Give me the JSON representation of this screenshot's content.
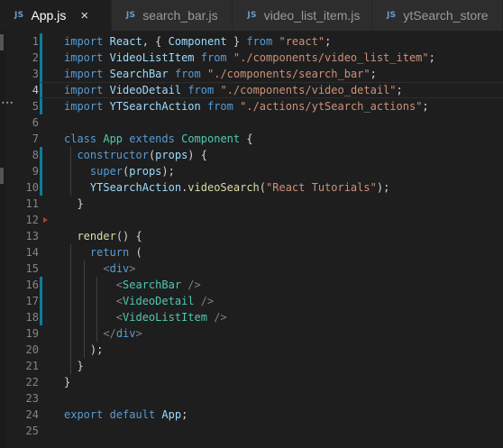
{
  "tabs": [
    {
      "icon": "JS",
      "label": "App.js",
      "active": true,
      "close": "×"
    },
    {
      "icon": "JS",
      "label": "search_bar.js",
      "active": false
    },
    {
      "icon": "JS",
      "label": "video_list_item.js",
      "active": false
    },
    {
      "icon": "JS",
      "label": "ytSearch_store",
      "active": false
    }
  ],
  "current_line": 4,
  "lines": [
    {
      "n": 1,
      "tokens": [
        [
          "kw",
          "import"
        ],
        [
          "pun",
          " "
        ],
        [
          "id",
          "React"
        ],
        [
          "pun",
          ", { "
        ],
        [
          "id",
          "Component"
        ],
        [
          "pun",
          " } "
        ],
        [
          "kw",
          "from"
        ],
        [
          "pun",
          " "
        ],
        [
          "str",
          "\"react\""
        ],
        [
          "pun",
          ";"
        ]
      ]
    },
    {
      "n": 2,
      "tokens": [
        [
          "kw",
          "import"
        ],
        [
          "pun",
          " "
        ],
        [
          "id",
          "VideoListItem"
        ],
        [
          "pun",
          " "
        ],
        [
          "kw",
          "from"
        ],
        [
          "pun",
          " "
        ],
        [
          "str",
          "\"./components/video_list_item\""
        ],
        [
          "pun",
          ";"
        ]
      ]
    },
    {
      "n": 3,
      "tokens": [
        [
          "kw",
          "import"
        ],
        [
          "pun",
          " "
        ],
        [
          "id",
          "SearchBar"
        ],
        [
          "pun",
          " "
        ],
        [
          "kw",
          "from"
        ],
        [
          "pun",
          " "
        ],
        [
          "str",
          "\"./components/search_bar\""
        ],
        [
          "pun",
          ";"
        ]
      ]
    },
    {
      "n": 4,
      "tokens": [
        [
          "kw",
          "import"
        ],
        [
          "pun",
          " "
        ],
        [
          "id",
          "VideoDetail"
        ],
        [
          "pun",
          " "
        ],
        [
          "kw",
          "from"
        ],
        [
          "pun",
          " "
        ],
        [
          "str",
          "\"./components/video_detail\""
        ],
        [
          "pun",
          ";"
        ]
      ]
    },
    {
      "n": 5,
      "tokens": [
        [
          "kw",
          "import"
        ],
        [
          "pun",
          " "
        ],
        [
          "id",
          "YTSearchAction"
        ],
        [
          "pun",
          " "
        ],
        [
          "kw",
          "from"
        ],
        [
          "pun",
          " "
        ],
        [
          "str",
          "\"./actions/ytSearch_actions\""
        ],
        [
          "pun",
          ";"
        ]
      ]
    },
    {
      "n": 6,
      "tokens": []
    },
    {
      "n": 7,
      "tokens": [
        [
          "kw",
          "class"
        ],
        [
          "pun",
          " "
        ],
        [
          "cls",
          "App"
        ],
        [
          "pun",
          " "
        ],
        [
          "kw",
          "extends"
        ],
        [
          "pun",
          " "
        ],
        [
          "cls",
          "Component"
        ],
        [
          "pun",
          " {"
        ]
      ]
    },
    {
      "n": 8,
      "tokens": [
        [
          "pun",
          "  "
        ],
        [
          "kw",
          "constructor"
        ],
        [
          "pun",
          "("
        ],
        [
          "id",
          "props"
        ],
        [
          "pun",
          ") {"
        ]
      ]
    },
    {
      "n": 9,
      "tokens": [
        [
          "pun",
          "    "
        ],
        [
          "kw",
          "super"
        ],
        [
          "pun",
          "("
        ],
        [
          "id",
          "props"
        ],
        [
          "pun",
          ");"
        ]
      ]
    },
    {
      "n": 10,
      "tokens": [
        [
          "pun",
          "    "
        ],
        [
          "id",
          "YTSearchAction"
        ],
        [
          "pun",
          "."
        ],
        [
          "fn",
          "videoSearch"
        ],
        [
          "pun",
          "("
        ],
        [
          "str",
          "\"React Tutorials\""
        ],
        [
          "pun",
          ");"
        ]
      ]
    },
    {
      "n": 11,
      "tokens": [
        [
          "pun",
          "  }"
        ]
      ]
    },
    {
      "n": 12,
      "tokens": []
    },
    {
      "n": 13,
      "tokens": [
        [
          "pun",
          "  "
        ],
        [
          "fn",
          "render"
        ],
        [
          "pun",
          "() {"
        ]
      ]
    },
    {
      "n": 14,
      "tokens": [
        [
          "pun",
          "    "
        ],
        [
          "kw",
          "return"
        ],
        [
          "pun",
          " ("
        ]
      ]
    },
    {
      "n": 15,
      "tokens": [
        [
          "pun",
          "      "
        ],
        [
          "tagp",
          "<"
        ],
        [
          "tag",
          "div"
        ],
        [
          "tagp",
          ">"
        ]
      ]
    },
    {
      "n": 16,
      "tokens": [
        [
          "pun",
          "        "
        ],
        [
          "tagp",
          "<"
        ],
        [
          "cls",
          "SearchBar"
        ],
        [
          "pun",
          " "
        ],
        [
          "tagp",
          "/>"
        ]
      ]
    },
    {
      "n": 17,
      "tokens": [
        [
          "pun",
          "        "
        ],
        [
          "tagp",
          "<"
        ],
        [
          "cls",
          "VideoDetail"
        ],
        [
          "pun",
          " "
        ],
        [
          "tagp",
          "/>"
        ]
      ]
    },
    {
      "n": 18,
      "tokens": [
        [
          "pun",
          "        "
        ],
        [
          "tagp",
          "<"
        ],
        [
          "cls",
          "VideoListItem"
        ],
        [
          "pun",
          " "
        ],
        [
          "tagp",
          "/>"
        ]
      ]
    },
    {
      "n": 19,
      "tokens": [
        [
          "pun",
          "      "
        ],
        [
          "tagp",
          "</"
        ],
        [
          "tag",
          "div"
        ],
        [
          "tagp",
          ">"
        ]
      ]
    },
    {
      "n": 20,
      "tokens": [
        [
          "pun",
          "    );"
        ]
      ]
    },
    {
      "n": 21,
      "tokens": [
        [
          "pun",
          "  }"
        ]
      ]
    },
    {
      "n": 22,
      "tokens": [
        [
          "pun",
          "}"
        ]
      ]
    },
    {
      "n": 23,
      "tokens": []
    },
    {
      "n": 24,
      "tokens": [
        [
          "kw",
          "export"
        ],
        [
          "pun",
          " "
        ],
        [
          "kw",
          "default"
        ],
        [
          "pun",
          " "
        ],
        [
          "id",
          "App"
        ],
        [
          "pun",
          ";"
        ]
      ]
    },
    {
      "n": 25,
      "tokens": []
    }
  ],
  "modified_lines": [
    1,
    2,
    3,
    4,
    5,
    8,
    9,
    10,
    16,
    17,
    18
  ],
  "fold_marker_line": 12
}
